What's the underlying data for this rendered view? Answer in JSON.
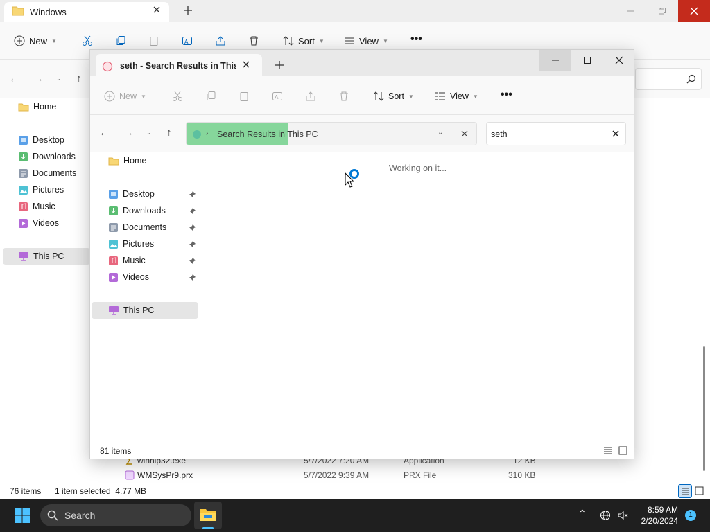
{
  "back_window": {
    "tab_title": "Windows",
    "toolbar": {
      "new_label": "New",
      "sort_label": "Sort",
      "view_label": "View"
    },
    "sidebar": {
      "home": "Home",
      "items": [
        "Desktop",
        "Downloads",
        "Documents",
        "Pictures",
        "Music",
        "Videos"
      ],
      "this_pc": "This PC"
    },
    "files": [
      {
        "name": "winhlp32.exe",
        "date": "5/7/2022 7:20 AM",
        "type": "Application",
        "size": "12 KB"
      },
      {
        "name": "WMSysPr9.prx",
        "date": "5/7/2022 9:39 AM",
        "type": "PRX File",
        "size": "310 KB"
      }
    ],
    "status": {
      "count": "76 items",
      "selected": "1 item selected  4.77 MB"
    }
  },
  "front_window": {
    "tab_title": "seth - Search Results in This P",
    "toolbar": {
      "new_label": "New",
      "sort_label": "Sort",
      "view_label": "View"
    },
    "address": {
      "text": "Search Results in This PC",
      "progress": 0.35
    },
    "search": {
      "value": "seth"
    },
    "sidebar": {
      "home": "Home",
      "items": [
        "Desktop",
        "Downloads",
        "Documents",
        "Pictures",
        "Music",
        "Videos"
      ],
      "this_pc": "This PC"
    },
    "working_text": "Working on it...",
    "status": {
      "count": "81 items"
    }
  },
  "taskbar": {
    "search_label": "Search",
    "time": "8:59 AM",
    "date": "2/20/2024",
    "notification_count": "1"
  },
  "colors": {
    "accent": "#0067c0",
    "progress": "#86d69b",
    "close_red": "#c42b1c",
    "taskbar": "#1f1f1f"
  }
}
